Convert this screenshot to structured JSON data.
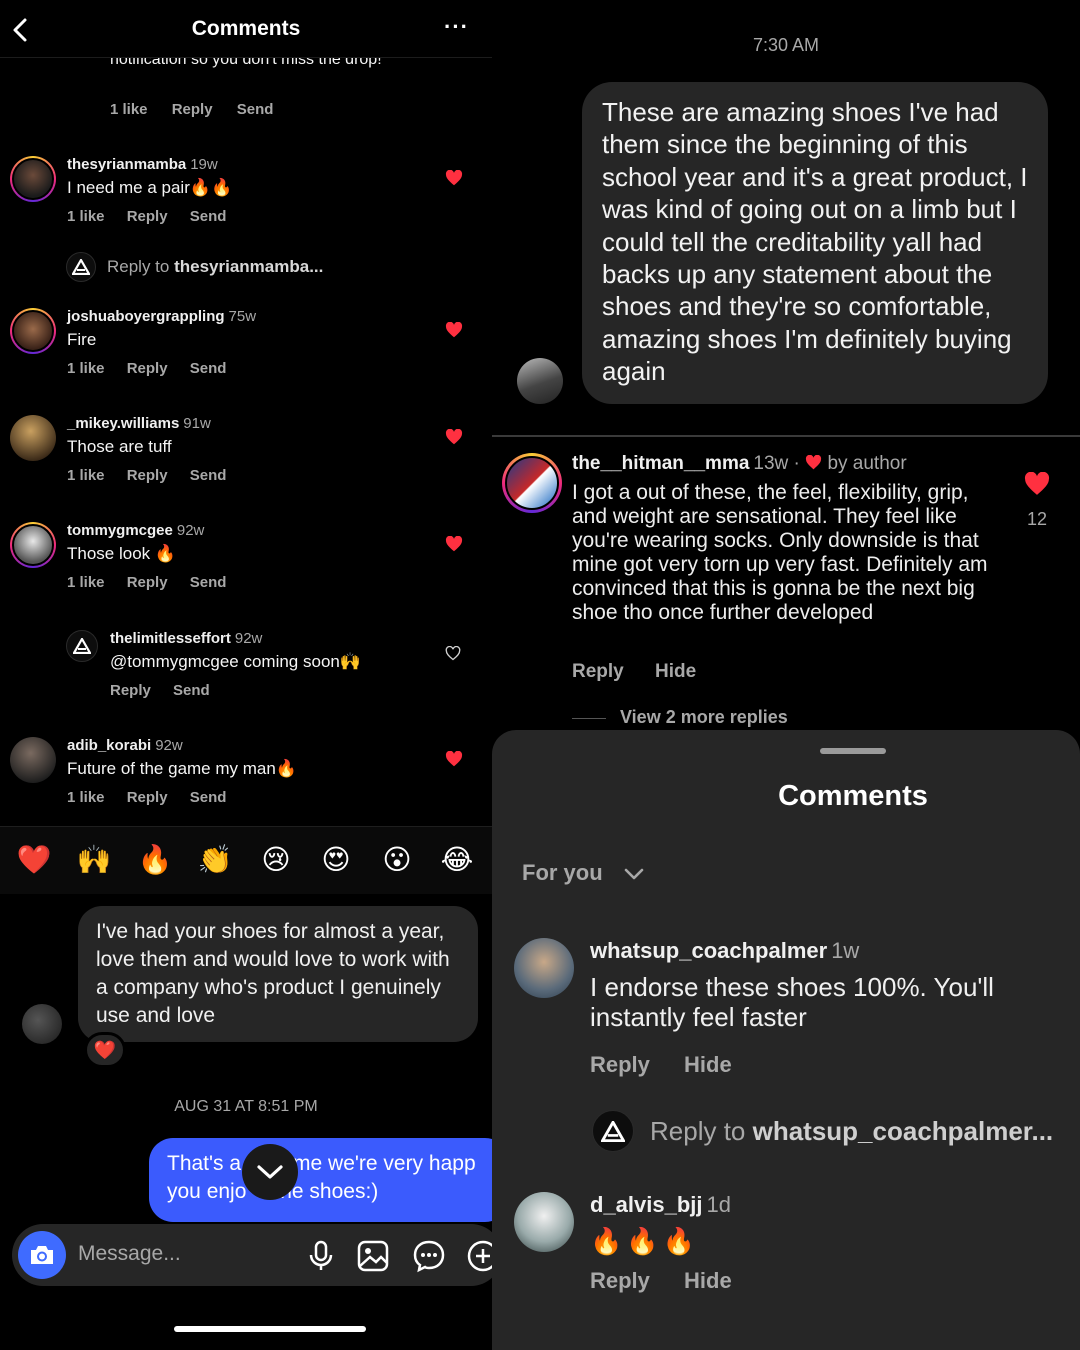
{
  "left": {
    "header": {
      "title": "Comments"
    },
    "truncated_comment": {
      "text": "notification so you don't miss the drop!",
      "likes": "1 like",
      "reply": "Reply",
      "send": "Send"
    },
    "comments": [
      {
        "user": "thesyrianmamba",
        "age": "19w",
        "text": "I need me a pair🔥🔥",
        "likes": "1 like",
        "reply": "Reply",
        "send": "Send",
        "liked": true
      },
      {
        "user": "joshuaboyergrappling",
        "age": "75w",
        "text": "Fire",
        "likes": "1 like",
        "reply": "Reply",
        "send": "Send",
        "liked": true
      },
      {
        "user": "_mikey.williams",
        "age": "91w",
        "text": "Those are tuff",
        "likes": "1 like",
        "reply": "Reply",
        "send": "Send",
        "liked": true
      },
      {
        "user": "tommygmcgee",
        "age": "92w",
        "text": "Those look 🔥",
        "likes": "1 like",
        "reply": "Reply",
        "send": "Send",
        "liked": true
      },
      {
        "user": "adib_korabi",
        "age": "92w",
        "text": "Future of the game my man🔥",
        "likes": "1 like",
        "reply": "Reply",
        "send": "Send",
        "liked": true
      }
    ],
    "reply_to": {
      "prefix": "Reply to ",
      "user": "thesyrianmamba..."
    },
    "nested_reply": {
      "user": "thelimitlesseffort",
      "age": "92w",
      "text": "@tommygmcgee coming soon🙌",
      "reply": "Reply",
      "send": "Send"
    },
    "emoji_bar": [
      "❤️",
      "🙌",
      "🔥",
      "👏",
      "😢",
      "😍",
      "😮",
      "😂"
    ],
    "dm": {
      "incoming": "I've had your shoes for almost a year, love them and would love to work with a company who's product I genuinely use and love",
      "reaction": "❤️",
      "date": "AUG 31 AT 8:51 PM",
      "outgoing": "That's a [...]me we're very happy you enjo[...] the shoes:)",
      "outgoing_line1": "That's a",
      "outgoing_line1b": "me we're very happ",
      "outgoing_line2": "you enjo",
      "outgoing_line2b": "the shoes:)",
      "composer_placeholder": "Message..."
    }
  },
  "right_top": {
    "time": "7:30 AM",
    "message": "These are amazing shoes I've had them since the beginning of this school year and it's a great product, I was kind of going out on a limb but I could tell the creditability yall had backs up any statement about the shoes and they're so comfortable, amazing shoes I'm definitely buying again"
  },
  "right_mid": {
    "user": "the__hitman__mma",
    "age": "13w",
    "separator": "·",
    "by_author": "by author",
    "text": "I got a out of these, the feel, flexibility, grip, and weight are sensational. They feel like you're wearing socks. Only downside is that mine got very torn up very fast. Definitely am convinced that this is gonna be the next big shoe tho once further developed",
    "reply": "Reply",
    "hide": "Hide",
    "like_count": "12",
    "more_replies": "View 2 more replies"
  },
  "sheet": {
    "title": "Comments",
    "sort": "For you",
    "comments": [
      {
        "user": "whatsup_coachpalmer",
        "age": "1w",
        "text": "I endorse these shoes 100%. You'll instantly feel faster",
        "reply": "Reply",
        "hide": "Hide"
      },
      {
        "user": "d_alvis_bjj",
        "age": "1d",
        "text": "🔥🔥🔥",
        "reply": "Reply",
        "hide": "Hide"
      }
    ],
    "reply_to": {
      "prefix": "Reply to ",
      "user": "whatsup_coachpalmer..."
    }
  },
  "colors": {
    "like_red": "#ff3040",
    "send_blue": "#3b5bfd",
    "bubble_gray": "#262626",
    "muted_text": "#a8a8a8"
  }
}
